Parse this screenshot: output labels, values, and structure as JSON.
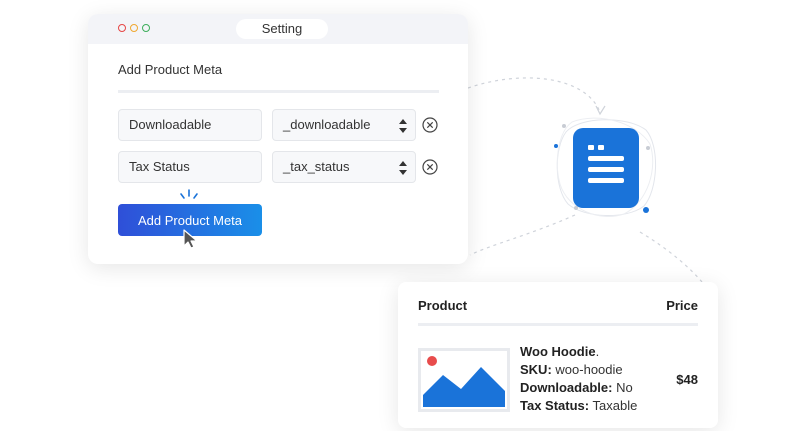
{
  "window": {
    "title": "Setting"
  },
  "form": {
    "section_title": "Add Product Meta",
    "rows": [
      {
        "name": "Downloadable",
        "key": "_downloadable"
      },
      {
        "name": "Tax Status",
        "key": "_tax_status"
      }
    ],
    "add_button_label": "Add Product Meta"
  },
  "table": {
    "col_product": "Product",
    "col_price": "Price",
    "product": {
      "name": "Woo Hoodie",
      "name_suffix": ".",
      "sku_label": "SKU:",
      "sku": "woo-hoodie",
      "downloadable_label": "Downloadable:",
      "downloadable": "No",
      "tax_label": "Tax Status:",
      "tax": "Taxable",
      "price": "$48"
    }
  },
  "colors": {
    "accent_blue": "#1a73d9",
    "button_gradient_start": "#2f4fd8",
    "button_gradient_end": "#1a8fe8",
    "dot_red": "#e64646",
    "dot_yellow": "#f0a830",
    "dot_green": "#3dae5b",
    "thumb_red_dot": "#e84c4c"
  },
  "icons": [
    "document-list-icon",
    "image-placeholder-icon",
    "cursor-icon",
    "remove-icon",
    "select-updown-icon"
  ]
}
